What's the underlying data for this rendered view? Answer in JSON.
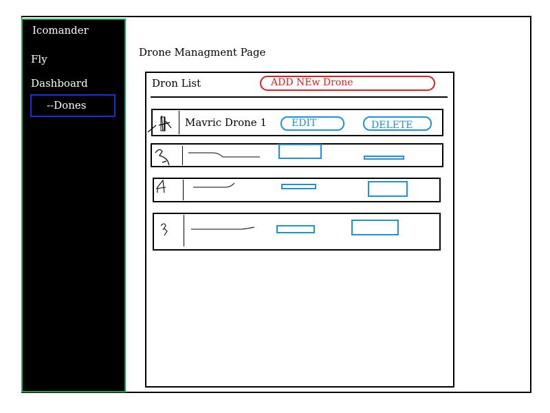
{
  "sidebar": {
    "app_name": "Icomander",
    "items": [
      {
        "label": "Fly"
      },
      {
        "label": "Dashboard"
      },
      {
        "label": "--Dones"
      }
    ]
  },
  "main": {
    "page_title": "Drone Managment Page",
    "list": {
      "title": "Dron List",
      "add_button": "ADD NEw Drone",
      "rows": [
        {
          "name": "Mavric Drone 1",
          "edit": "EDIT",
          "delete": "DELETE"
        }
      ]
    }
  },
  "colors": {
    "sidebar_bg": "#000000",
    "sidebar_border": "#1aa04f",
    "active_item_border": "#1a2fe0",
    "add_button": "#d42020",
    "action_buttons": "#1e90d6"
  }
}
